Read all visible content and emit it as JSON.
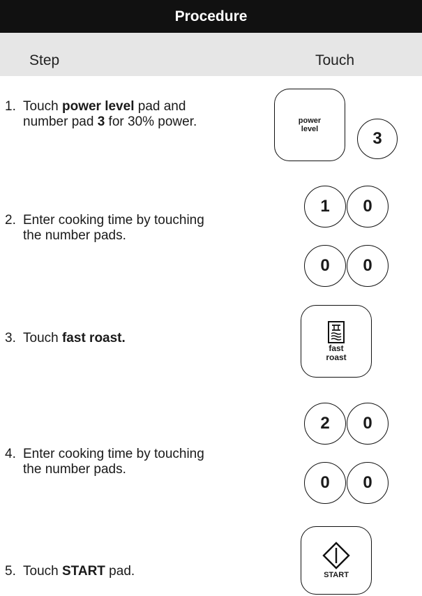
{
  "header": {
    "title": "Procedure"
  },
  "columns": {
    "step": "Step",
    "touch": "Touch"
  },
  "steps": [
    {
      "num": "1.",
      "parts": [
        {
          "t": "Touch ",
          "b": false
        },
        {
          "t": "power level",
          "b": true
        },
        {
          "t": " pad and number pad ",
          "b": false
        },
        {
          "t": "3",
          "b": true
        },
        {
          "t": " for 30% power.",
          "b": false
        }
      ]
    },
    {
      "num": "2.",
      "parts": [
        {
          "t": "Enter cooking time by touching the number pads.",
          "b": false
        }
      ]
    },
    {
      "num": "3.",
      "parts": [
        {
          "t": "Touch ",
          "b": false
        },
        {
          "t": "fast roast.",
          "b": true
        }
      ]
    },
    {
      "num": "4.",
      "parts": [
        {
          "t": "Enter cooking time by touching the number pads.",
          "b": false
        }
      ]
    },
    {
      "num": "5.",
      "parts": [
        {
          "t": "Touch ",
          "b": false
        },
        {
          "t": "START",
          "b": true
        },
        {
          "t": " pad.",
          "b": false
        }
      ]
    }
  ],
  "pads": {
    "power_level_line1": "power",
    "power_level_line2": "level",
    "num3": "3",
    "step2": [
      "1",
      "0",
      "0",
      "0"
    ],
    "fast_roast_line1": "fast",
    "fast_roast_line2": "roast",
    "step4": [
      "2",
      "0",
      "0",
      "0"
    ],
    "start": "START"
  },
  "colors": {
    "header_bg": "#111111",
    "subheader_bg": "#e6e6e6"
  },
  "icons": {
    "fast_roast": "fast-roast-icon",
    "start": "start-diamond-icon"
  }
}
